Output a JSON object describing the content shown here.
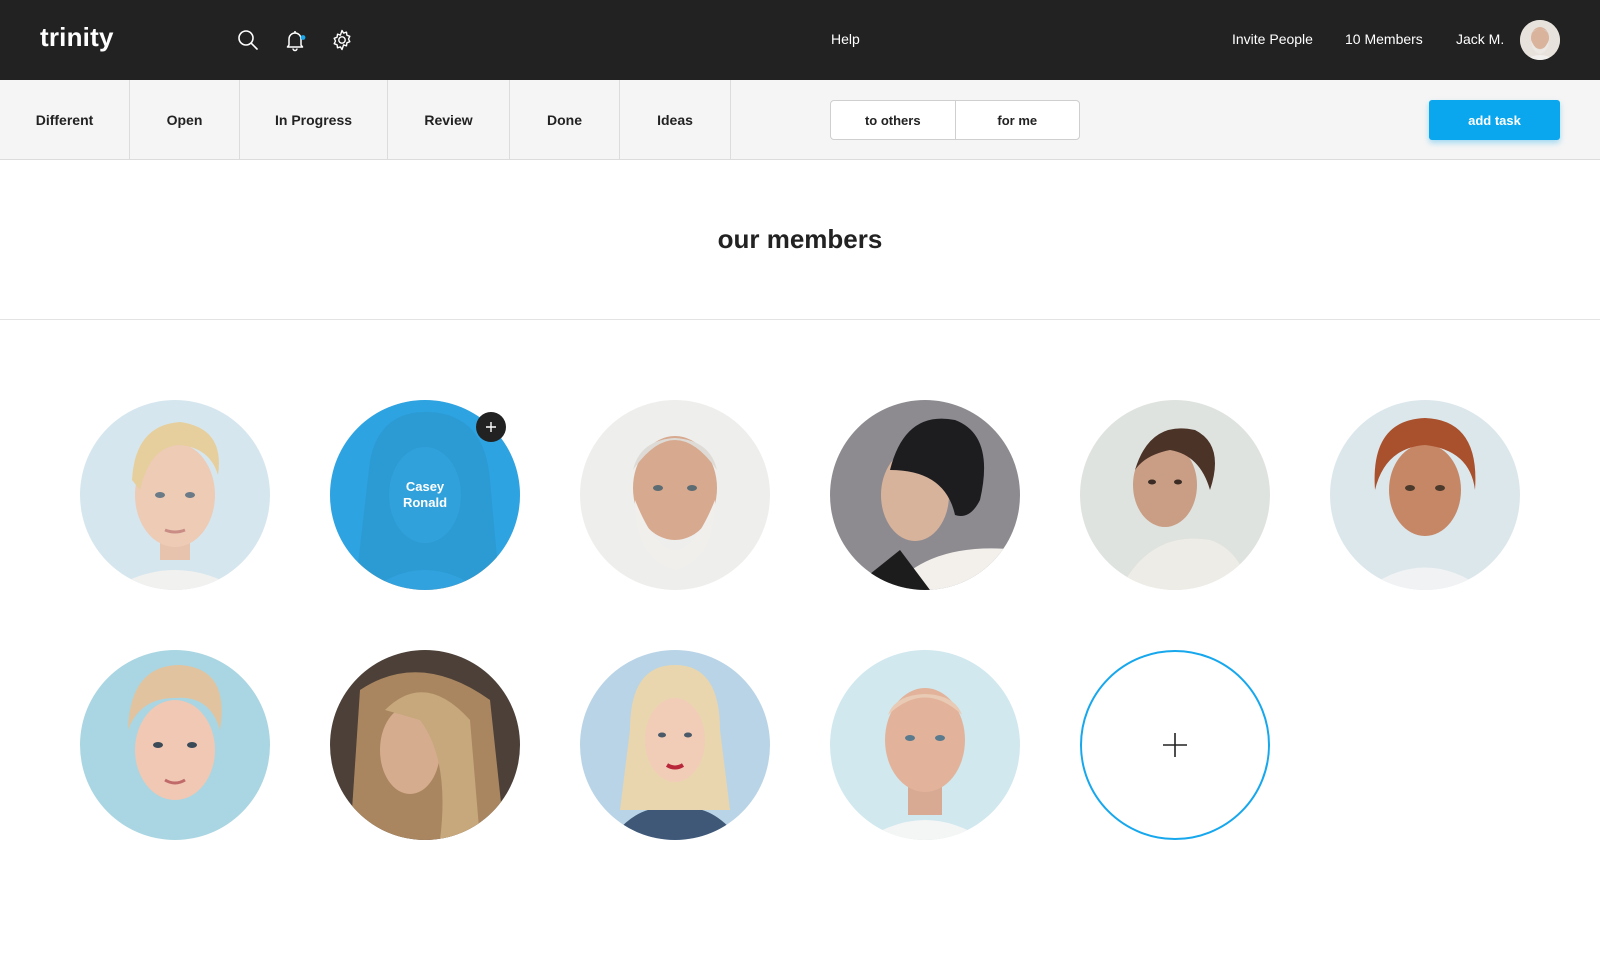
{
  "app": {
    "logo": "trinity"
  },
  "topbar": {
    "icons": [
      "search-icon",
      "bell-icon",
      "gear-icon"
    ],
    "notification_dot_color": "#1aa8ee",
    "help": "Help",
    "invite": "Invite People",
    "members_count": "10 Members",
    "user_name": "Jack M."
  },
  "tabs": [
    {
      "label": "Different"
    },
    {
      "label": "Open"
    },
    {
      "label": "In Progress"
    },
    {
      "label": "Review"
    },
    {
      "label": "Done"
    },
    {
      "label": "Ideas"
    }
  ],
  "filter": {
    "to_others": "to others",
    "for_me": "for me"
  },
  "add_task": "add task",
  "page_title": "our members",
  "members": [
    {
      "hovered": false
    },
    {
      "hovered": true,
      "name": "Casey Ronald"
    },
    {
      "hovered": false
    },
    {
      "hovered": false
    },
    {
      "hovered": false
    },
    {
      "hovered": false
    },
    {
      "hovered": false
    },
    {
      "hovered": false
    },
    {
      "hovered": false
    },
    {
      "hovered": false
    }
  ],
  "colors": {
    "accent": "#0aa7ee",
    "topbar": "#222222",
    "subnav": "#f5f5f5",
    "hover_overlay": "#179be1"
  }
}
